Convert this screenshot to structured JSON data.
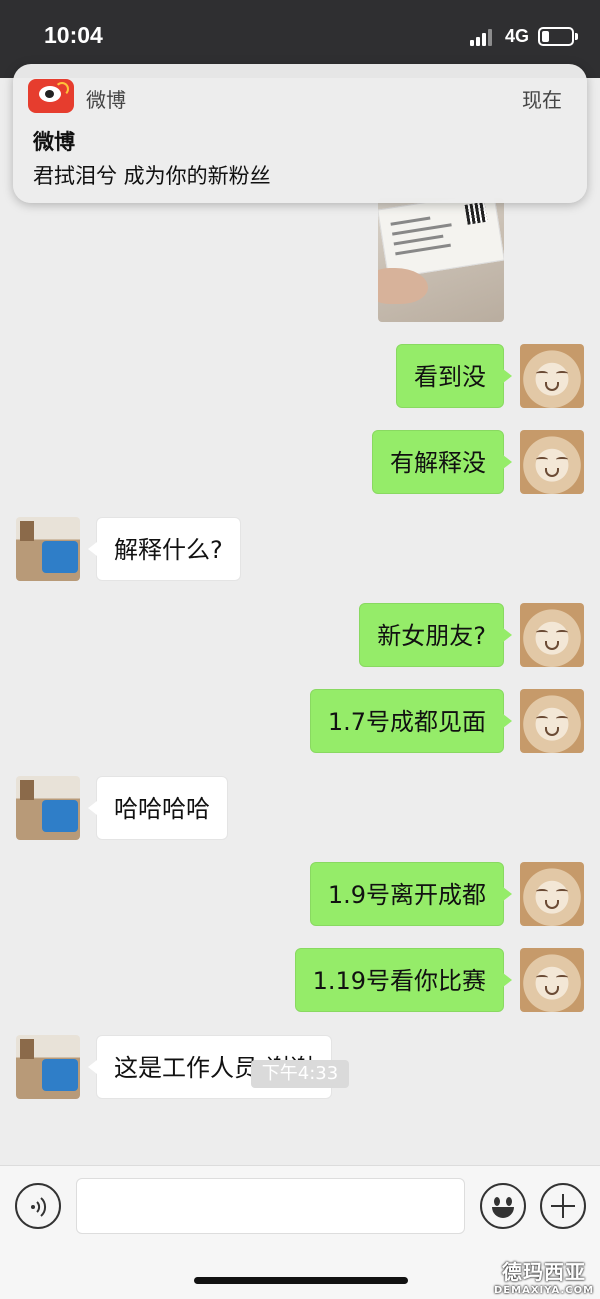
{
  "status_bar": {
    "time": "10:04",
    "network": "4G",
    "battery_level": 0.25
  },
  "notification": {
    "app_name": "微博",
    "time": "现在",
    "title": "微博",
    "body": "君拭泪兮 成为你的新粉丝",
    "icon": "weibo-icon",
    "accent_color": "#e63d2e"
  },
  "chat": {
    "messages": [
      {
        "sender": "self",
        "type": "image"
      },
      {
        "sender": "self",
        "text": "看到没"
      },
      {
        "sender": "self",
        "text": "有解释没"
      },
      {
        "sender": "friend",
        "text": "解释什么?"
      },
      {
        "sender": "self",
        "text": "新女朋友?"
      },
      {
        "sender": "self",
        "text": "1.7号成都见面"
      },
      {
        "sender": "friend",
        "text": "哈哈哈哈"
      },
      {
        "sender": "self",
        "text": "1.9号离开成都"
      },
      {
        "sender": "self",
        "text": "1.19号看你比赛"
      },
      {
        "sender": "friend",
        "text": "这是工作人员 谢谢"
      }
    ],
    "timestamp": "下午4:33",
    "self_bubble_color": "#95ec69",
    "friend_bubble_color": "#ffffff"
  },
  "input_bar": {
    "voice_icon": "voice-icon",
    "emoji_icon": "emoji-icon",
    "plus_icon": "plus-icon"
  },
  "watermark": {
    "cn": "德玛西亚",
    "en": "DEMAXIYA.COM"
  }
}
